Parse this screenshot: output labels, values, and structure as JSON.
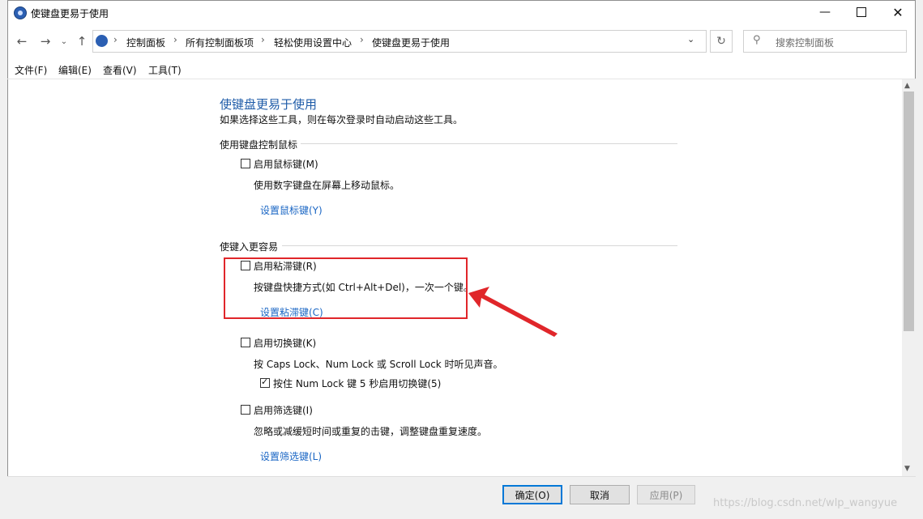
{
  "window": {
    "title": "使键盘更易于使用",
    "app_icon": "control-panel-icon",
    "controls": [
      "minimize-icon",
      "maximize-icon",
      "close-icon"
    ]
  },
  "address_bar": {
    "breadcrumbs": [
      "控制面板",
      "所有控制面板项",
      "轻松使用设置中心",
      "使键盘更易于使用"
    ],
    "separator": "›",
    "search_placeholder": "搜索控制面板"
  },
  "menubar": {
    "items": [
      "文件(F)",
      "编辑(E)",
      "查看(V)",
      "工具(T)"
    ]
  },
  "content": {
    "title": "使键盘更易于使用",
    "subtitle": "如果选择这些工具，则在每次登录时自动启动这些工具。",
    "sections": [
      {
        "heading": "使用键盘控制鼠标",
        "options": [
          {
            "label": "启用鼠标键(M)",
            "checked": false,
            "description": "使用数字键盘在屏幕上移动鼠标。",
            "link": "设置鼠标键(Y)"
          }
        ]
      },
      {
        "heading": "使键入更容易",
        "options": [
          {
            "label": "启用粘滞键(R)",
            "checked": false,
            "description": "按键盘快捷方式(如 Ctrl+Alt+Del)，一次一个键。",
            "link": "设置粘滞键(C)"
          },
          {
            "label": "启用切换键(K)",
            "checked": false,
            "description": "按 Caps Lock、Num Lock 或 Scroll Lock 时听见声音。",
            "sub_option": {
              "label": "按住 Num Lock 键 5 秒启用切换键(5)",
              "checked": true
            }
          },
          {
            "label": "启用筛选键(I)",
            "checked": false,
            "description": "忽略或减缓短时间或重复的击键，调整键盘重复速度。",
            "link": "设置筛选键(L)"
          }
        ]
      }
    ]
  },
  "buttons": {
    "ok": "确定(O)",
    "cancel": "取消",
    "apply": "应用(P)"
  },
  "watermark": "https://blog.csdn.net/wlp_wangyue",
  "annotation": {
    "highlight_color": "#e0262a"
  }
}
